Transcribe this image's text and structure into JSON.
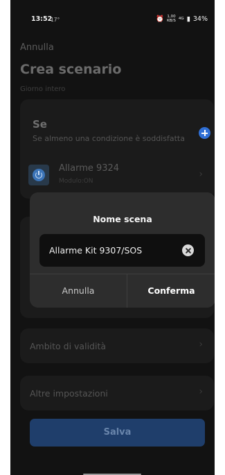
{
  "status_bar": {
    "time": "13:52",
    "temperature": "17°",
    "speed_value": "1,00",
    "speed_unit": "KB/S",
    "network": "4G",
    "battery": "34%"
  },
  "header": {
    "cancel_label": "Annulla",
    "title": "Crea scenario",
    "subtitle": "Giorno intero"
  },
  "if_section": {
    "title": "Se",
    "description": "Se almeno una condizione è soddisfatta",
    "add_icon": "plus-circle-icon",
    "condition": {
      "name": "Allarme 9324",
      "detail": "Modulo:ON",
      "icon": "power-icon"
    }
  },
  "rows": {
    "validity_label": "Ambito di validità",
    "other_settings_label": "Altre impostazioni"
  },
  "save_label": "Salva",
  "dialog": {
    "title": "Nome scena",
    "input_value": "Allarme Kit 9307/SOS",
    "cancel_label": "Annulla",
    "confirm_label": "Conferma"
  },
  "colors": {
    "accent": "#2f6fd6",
    "background": "#121212",
    "dialog": "#2d2d2d"
  }
}
